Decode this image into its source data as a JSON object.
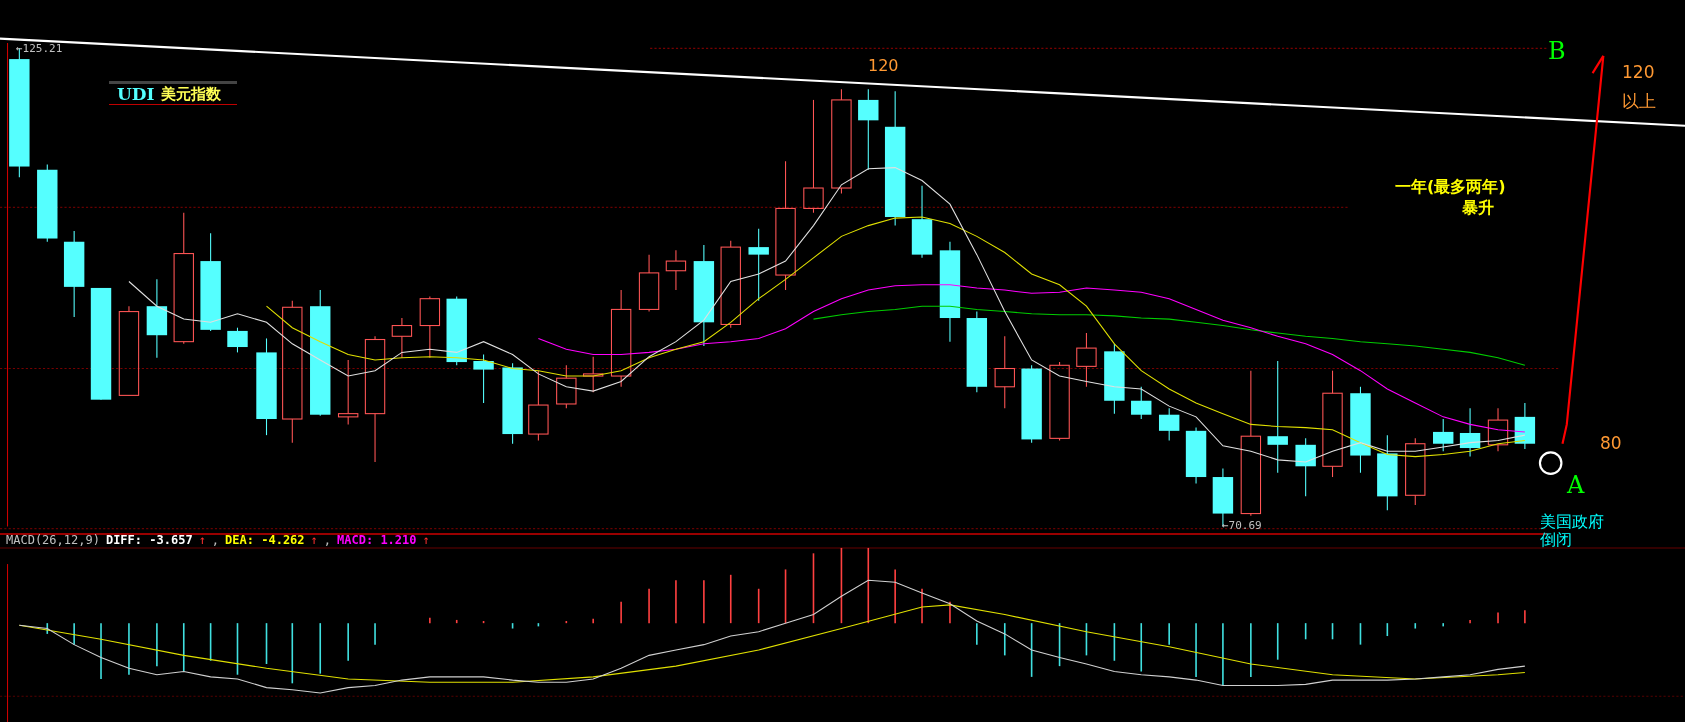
{
  "title": {
    "code": "UDI",
    "name": "美元指数"
  },
  "price_labels": {
    "high": "←125.21",
    "low": "←70.69"
  },
  "annotations": {
    "peak_value": "120",
    "point_b": "B",
    "target_value": "120",
    "target_note": "以上",
    "forecast": "一年(最多两年)",
    "forecast_note": "暴升",
    "current_value": "80",
    "point_a": "A",
    "event": "美国政府倒闭"
  },
  "macd": {
    "label": "MACD(26,12,9)",
    "separator": ",",
    "items": [
      {
        "text": "DIFF: -3.657",
        "arrow": "↑",
        "color": "#ffffff"
      },
      {
        "text": "DEA: -4.262",
        "arrow": "↑",
        "color": "#ffff00"
      },
      {
        "text": "MACD: 1.210",
        "arrow": "↑",
        "color": "#ff00ff"
      }
    ]
  }
}
